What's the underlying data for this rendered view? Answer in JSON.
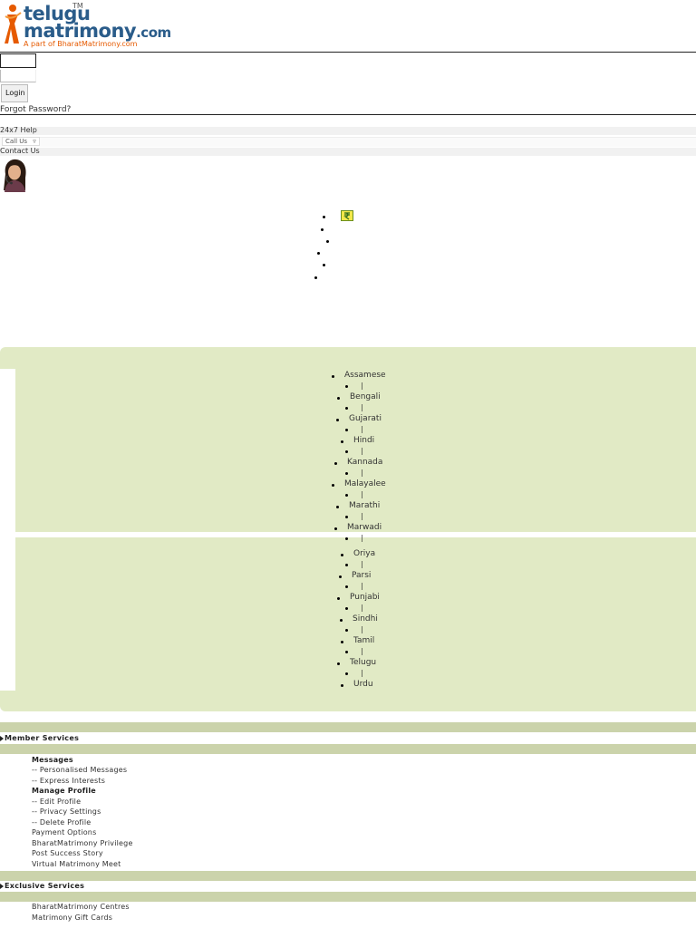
{
  "logo": {
    "word1": "telugu",
    "tm": "TM",
    "word2": "matrimony",
    "com": ".com",
    "tagline": "A part of BharatMatrimony.com"
  },
  "login": {
    "button_label": "Login",
    "forgot_link": "Forgot Password?"
  },
  "help": {
    "help_label": "24x7 Help",
    "call_us": "Call Us",
    "contact_us": "Contact Us"
  },
  "languages": {
    "group1": [
      "Assamese",
      "Bengali",
      "Gujarati",
      "Hindi",
      "Kannada",
      "Malayalee",
      "Marathi",
      "Marwadi"
    ],
    "group2": [
      "Oriya",
      "Parsi",
      "Punjabi",
      "Sindhi",
      "Tamil",
      "Telugu",
      "Urdu"
    ],
    "separator": "|"
  },
  "member_services": {
    "title": "Member Services",
    "items": [
      "Messages",
      "-- Personalised Messages",
      "-- Express Interests",
      "Manage Profile",
      "-- Edit Profile",
      "-- Privacy Settings",
      "-- Delete Profile",
      "Payment Options",
      "BharatMatrimony Privilege",
      "Post Success Story",
      "Virtual Matrimony Meet"
    ]
  },
  "exclusive_services": {
    "title": "Exclusive Services",
    "items": [
      "BharatMatrimony Centres",
      "Matrimony Gift Cards"
    ]
  },
  "colors": {
    "brand_blue": "#2a5c8a",
    "brand_orange": "#e65a00",
    "panel_green": "#e1eac5",
    "band_green": "#cbd3ab"
  }
}
